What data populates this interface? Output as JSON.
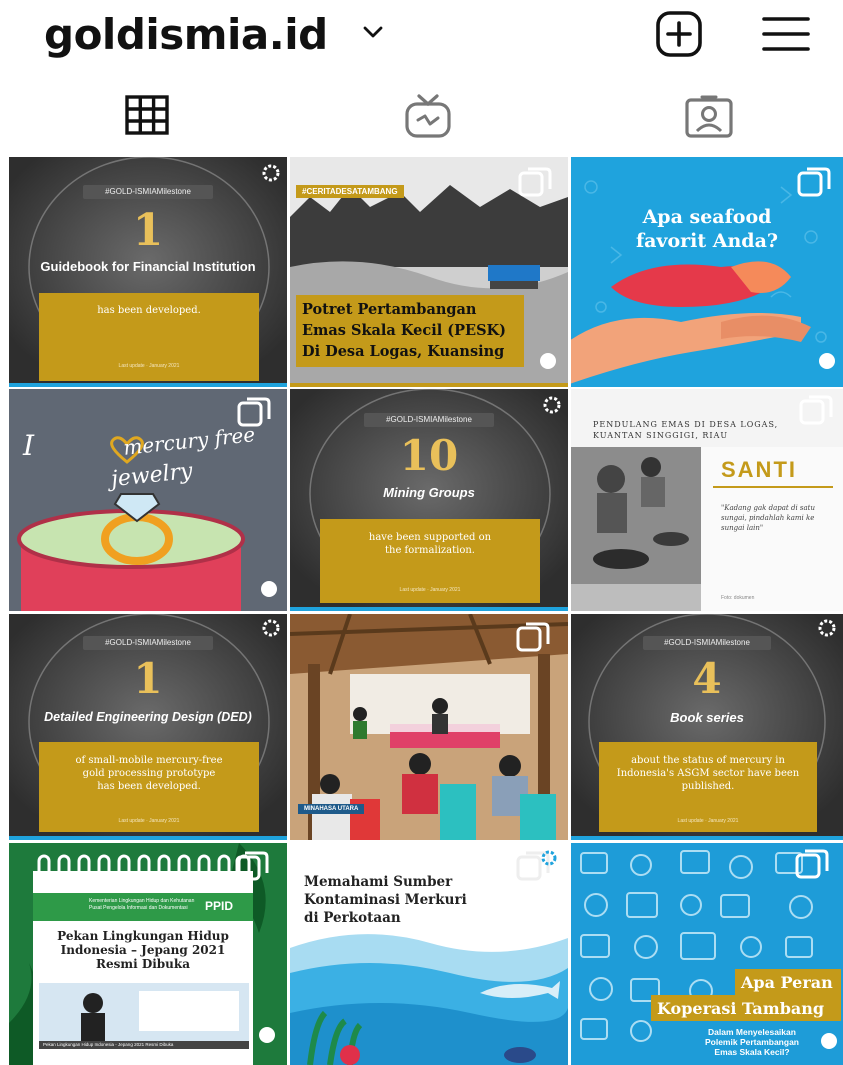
{
  "header": {
    "username": "goldismia.id",
    "icons": [
      "chevron-down-icon",
      "new-post-icon",
      "menu-icon"
    ]
  },
  "tabs": [
    {
      "name": "grid-icon",
      "active": true
    },
    {
      "name": "igtv-icon",
      "active": false
    },
    {
      "name": "tagged-icon",
      "active": false
    }
  ],
  "posts": {
    "p1": {
      "tag": "#GOLD-ISMIAMilestone",
      "number": "1",
      "title": "Guidebook for Financial Institution",
      "body": "has been developed.",
      "footer": "Last update · January 2021"
    },
    "p2": {
      "tag": "#CERITADESATAMBANG",
      "title_lines": [
        "Potret Pertambangan",
        "Emas Skala Kecil (PESK)",
        "Di Desa Logas, Kuansing"
      ]
    },
    "p3": {
      "title_lines": [
        "Apa seafood",
        "favorit Anda?"
      ]
    },
    "p4": {
      "line1": "I",
      "line1b": "mercury free",
      "line2": "jewelry"
    },
    "p5": {
      "tag": "#GOLD-ISMIAMilestone",
      "number": "10",
      "title": "Mining Groups",
      "body_lines": [
        "have been supported on",
        "the formalization."
      ],
      "footer": "Last update · January 2021"
    },
    "p6": {
      "header_lines": [
        "PENDULANG EMAS DI DESA LOGAS,",
        "KUANTAN SINGGIGI, RIAU"
      ],
      "name": "SANTI",
      "quote_lines": [
        "\"Kadang gak dapat di satu",
        "sungai, pindahlah kami ke",
        "sungai lain\""
      ],
      "credit": "Foto: dokumen"
    },
    "p7": {
      "tag": "#GOLD-ISMIAMilestone",
      "number": "1",
      "title": "Detailed Engineering Design (DED)",
      "body_lines": [
        "of small-mobile mercury-free",
        "gold processing prototype",
        "has been developed."
      ],
      "footer": "Last update · January 2021"
    },
    "p8": {
      "location": "MINAHASA UTARA"
    },
    "p9": {
      "tag": "#GOLD-ISMIAMilestone",
      "number": "4",
      "title": "Book series",
      "body_lines": [
        "about the status of mercury in",
        "Indonesia's ASGM sector have been",
        "published."
      ],
      "footer": "Last update · January 2021"
    },
    "p10": {
      "ppid": "PPID",
      "ministry_lines": [
        "Kementerian Lingkungan Hidup dan Kehutanan",
        "Pusat Pengelola Informasi dan Dokumentasi"
      ],
      "title_lines": [
        "Pekan Lingkungan Hidup",
        "Indonesia – Jepang 2021",
        "Resmi Dibuka"
      ],
      "caption": "Pekan Lingkungan Hidup Indonesia - Jepang 2021 Resmi Dibuka"
    },
    "p11": {
      "title_lines": [
        "Memahami Sumber",
        "Kontaminasi Merkuri",
        "di Perkotaan"
      ]
    },
    "p12": {
      "title_lines": [
        "Apa Peran",
        "Koperasi Tambang"
      ],
      "sub_lines": [
        "Dalam Menyelesaikan",
        "Polemik Pertambangan",
        "Emas Skala Kecil?"
      ]
    }
  },
  "colors": {
    "gold": "#c49a1a",
    "cyan": "#1fa3dd",
    "dark": "#3a3a3a",
    "green": "#1e8a3a"
  }
}
